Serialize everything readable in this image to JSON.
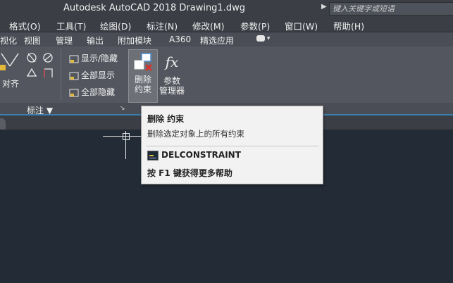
{
  "titlebar": {
    "app_title": "Autodesk AutoCAD 2018    Drawing1.dwg",
    "search_placeholder": "键入关键字或短语"
  },
  "menubar": {
    "items": [
      "格式(O)",
      "工具(T)",
      "绘图(D)",
      "标注(N)",
      "修改(M)",
      "参数(P)",
      "窗口(W)",
      "帮助(H)"
    ]
  },
  "ribbon_tabs": {
    "items": [
      "视化",
      "视图",
      "管理",
      "输出",
      "附加模块",
      "A360",
      "精选应用"
    ]
  },
  "ribbon": {
    "align_label": "对齐",
    "show_hide": "显示/隐藏",
    "show_all": "全部显示",
    "hide_all": "全部隐藏",
    "delete_line1": "删除",
    "delete_line2": "约束",
    "params_line1": "参数",
    "params_line2": "管理器",
    "fx_symbol": "fx",
    "panel_footer": "标注 ▼"
  },
  "tooltip": {
    "title": "删除 约束",
    "description": "删除选定对象上的所有约束",
    "command": "DELCONSTRAINT",
    "help": "按 F1 键获得更多帮助"
  },
  "colors": {
    "accent": "#3c7fb1",
    "canvas": "#222b36",
    "tooltip_bg": "#f2f2f2"
  }
}
